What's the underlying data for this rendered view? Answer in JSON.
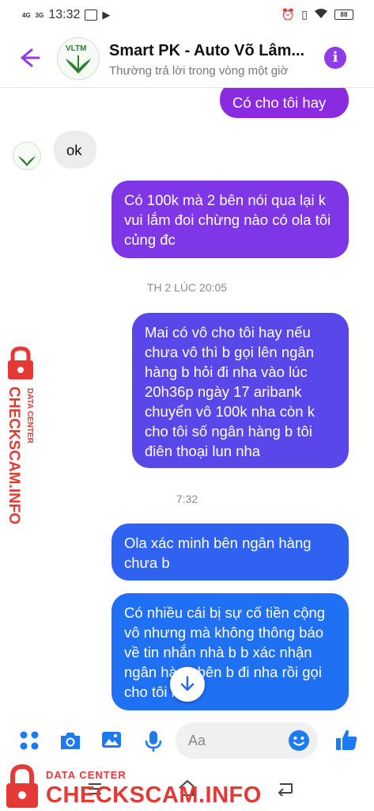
{
  "status_bar": {
    "network1": "4G",
    "network2": "3G",
    "time": "13:32",
    "battery": "88"
  },
  "header": {
    "title": "Smart PK - Auto Võ Lâm...",
    "subtitle": "Thường trả lời trong vòng một giờ",
    "avatar_text": "VLTM"
  },
  "messages": [
    {
      "side": "out",
      "text": "Có cho tôi hay"
    },
    {
      "side": "in",
      "text": "ok"
    },
    {
      "side": "out",
      "text": "Có 100k mà 2 bên nói qua lại k vui lắm đoi chừng nào có ola tôi củng đc"
    },
    {
      "side": "out",
      "text": "Mai có vô cho tôi hay nếu chưa vô thì b gọi lên ngân hàng b hỏi đi nha vào lúc 20h36p ngày 17 aribank chuyển vô 100k nha còn k cho tôi số ngân hàng b tôi điên thoại lun nha"
    },
    {
      "side": "out",
      "text": "Ola xác minh bên ngân hàng chưa b"
    },
    {
      "side": "out",
      "text": "Có nhiều cái bị sự cố tiền cộng vô nhưng mà không thông báo về tin nhắn nhà b b xác nhận ngân hàng bên b đi nha rồi gọi cho tôi hay"
    }
  ],
  "timestamps": [
    "TH 2 LÚC 20:05",
    "7:32"
  ],
  "composer": {
    "placeholder": "Aa"
  },
  "watermark": {
    "side_top": "DATA CENTER",
    "side_main": "CHECKSCAM.INFO",
    "bottom_top": "DATA CENTER",
    "bottom_main": "CHECKSCAM.INFO"
  },
  "colors": {
    "accent": "#8f3ce6",
    "bubble_top": "#8a2be2",
    "bubble_bottom": "#1f6ff2",
    "watermark": "#e53935"
  }
}
